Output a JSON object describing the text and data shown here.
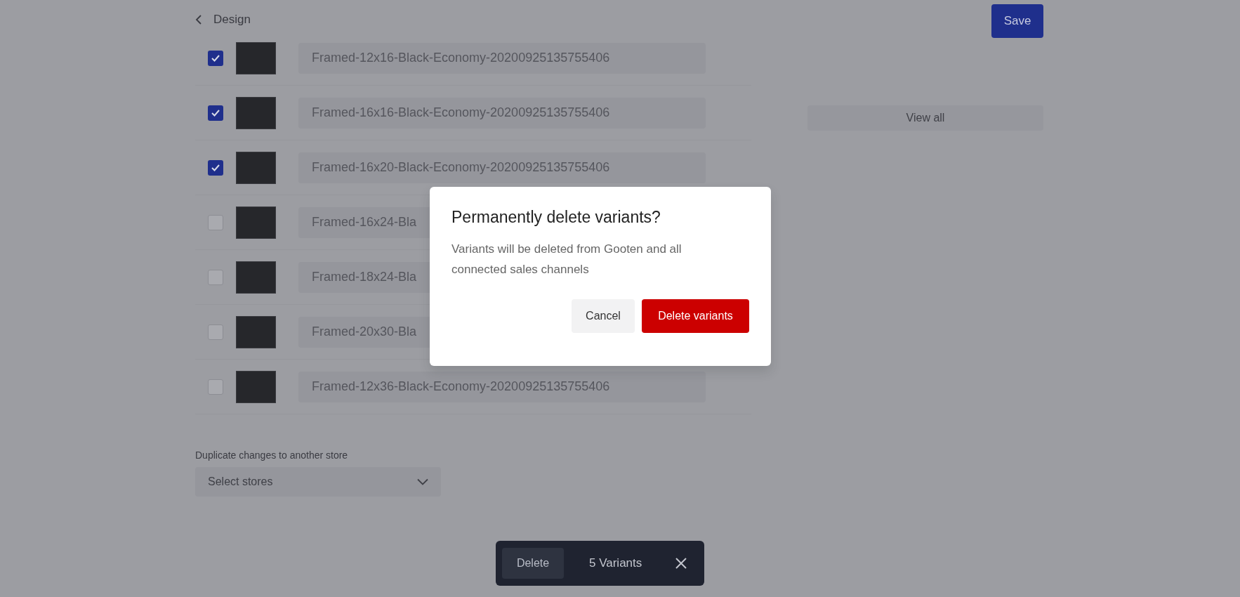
{
  "header": {
    "back_label": "Design"
  },
  "save_button": "Save",
  "variants": [
    {
      "name": "Framed-12x16-Black-Economy-20200925135755406",
      "checked": true
    },
    {
      "name": "Framed-16x16-Black-Economy-20200925135755406",
      "checked": true
    },
    {
      "name": "Framed-16x20-Black-Economy-20200925135755406",
      "checked": true
    },
    {
      "name": "Framed-16x24-Bla",
      "checked": false
    },
    {
      "name": "Framed-18x24-Bla",
      "checked": false
    },
    {
      "name": "Framed-20x30-Bla",
      "checked": false
    },
    {
      "name": "Framed-12x36-Black-Economy-20200925135755406",
      "checked": false
    }
  ],
  "view_all": "View all",
  "duplicate": {
    "label": "Duplicate changes to another store",
    "placeholder": "Select stores"
  },
  "dialog": {
    "title": "Permanently delete variants?",
    "message": "Variants will be deleted from Gooten and all connected sales channels",
    "cancel": "Cancel",
    "confirm": "Delete variants"
  },
  "selection_bar": {
    "action": "Delete",
    "count": "5 Variants"
  }
}
